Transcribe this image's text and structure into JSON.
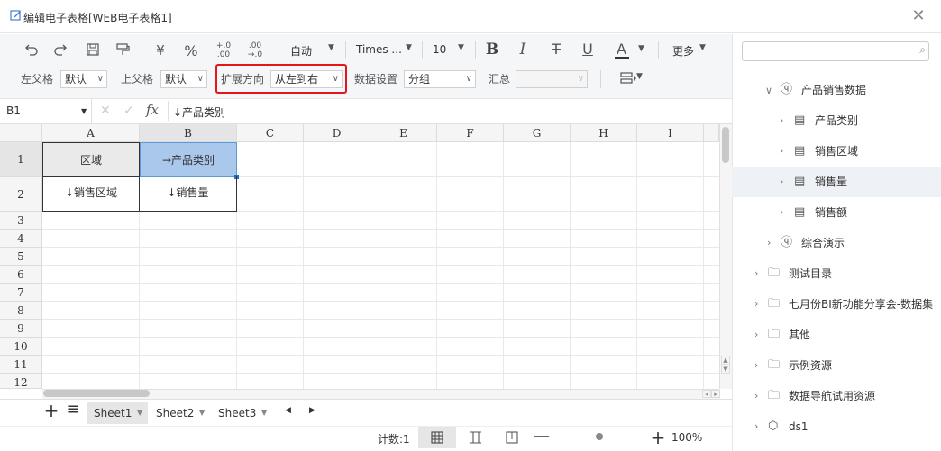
{
  "window": {
    "title": "编辑电子表格[WEB电子表格1]"
  },
  "toolbar": {
    "auto_label": "自动",
    "font_name": "Times ...",
    "font_size": "10",
    "more_label": "更多",
    "yuan_symbol": "¥",
    "percent_symbol": "%",
    "left_parent_label": "左父格",
    "left_parent_value": "默认",
    "top_parent_label": "上父格",
    "top_parent_value": "默认",
    "expand_dir_label": "扩展方向",
    "expand_dir_value": "从左到右",
    "data_setting_label": "数据设置",
    "data_setting_value": "分组",
    "summary_label": "汇总",
    "summary_value": ""
  },
  "formula_bar": {
    "cell_ref": "B1",
    "fx": "fx",
    "content": "↓产品类别"
  },
  "grid": {
    "columns": [
      "A",
      "B",
      "C",
      "D",
      "E",
      "F",
      "G",
      "H",
      "I"
    ],
    "rows": [
      "1",
      "2",
      "3",
      "4",
      "5",
      "6",
      "7",
      "8",
      "9",
      "10",
      "11",
      "12"
    ],
    "cells": {
      "A1": "区域",
      "B1": "→产品类别",
      "A2": "↓销售区域",
      "B2": "↓销售量"
    }
  },
  "sheets": {
    "tabs": [
      {
        "label": "Sheet1"
      },
      {
        "label": "Sheet2"
      },
      {
        "label": "Sheet3"
      }
    ],
    "add_symbol": "+",
    "list_symbol": "≡"
  },
  "status": {
    "count_label": "计数:1",
    "zoom": "100%"
  },
  "tree": {
    "search_placeholder": "",
    "items": [
      {
        "label": "产品销售数据"
      },
      {
        "label": "产品类别"
      },
      {
        "label": "销售区域"
      },
      {
        "label": "销售量"
      },
      {
        "label": "销售额"
      },
      {
        "label": "综合演示"
      },
      {
        "label": "测试目录"
      },
      {
        "label": "七月份BI新功能分享会-数据集"
      },
      {
        "label": "其他"
      },
      {
        "label": "示例资源"
      },
      {
        "label": "数据导航试用资源"
      },
      {
        "label": "ds1"
      }
    ]
  },
  "colors": {
    "accent": "#e5151a",
    "selected_cell": "#a9c8eb",
    "selection_border": "#5b9bd5"
  }
}
